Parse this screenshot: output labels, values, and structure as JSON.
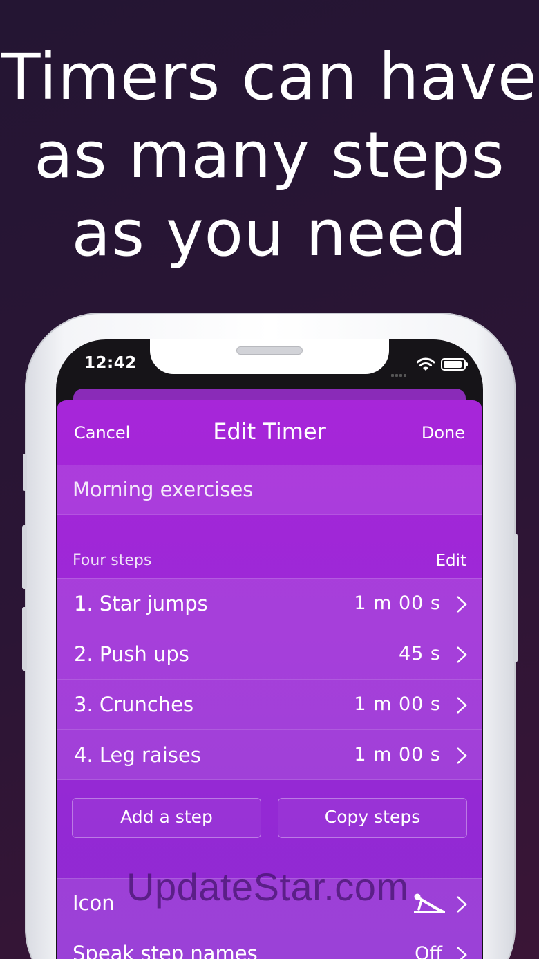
{
  "headline": [
    "Timers can have",
    "as many steps",
    "as you need"
  ],
  "status_bar": {
    "time": "12:42"
  },
  "nav": {
    "cancel": "Cancel",
    "title": "Edit Timer",
    "done": "Done"
  },
  "timer_name": "Morning exercises",
  "steps_section": {
    "header": "Four steps",
    "edit": "Edit"
  },
  "steps": [
    {
      "label": "1. Star jumps",
      "duration": "1 m  00 s"
    },
    {
      "label": "2. Push ups",
      "duration": "45 s"
    },
    {
      "label": "3. Crunches",
      "duration": "1 m  00 s"
    },
    {
      "label": "4. Leg raises",
      "duration": "1 m  00 s"
    }
  ],
  "buttons": {
    "add_step": "Add a step",
    "copy_steps": "Copy steps"
  },
  "options": [
    {
      "label": "Icon",
      "value": "",
      "icon": "exercise-pose-icon"
    },
    {
      "label": "Speak step names",
      "value": "Off"
    }
  ],
  "watermark": "UpdateStar.com",
  "colors": {
    "background": "#2b1535",
    "sheet": "#a726d9",
    "text": "#ffffff"
  }
}
